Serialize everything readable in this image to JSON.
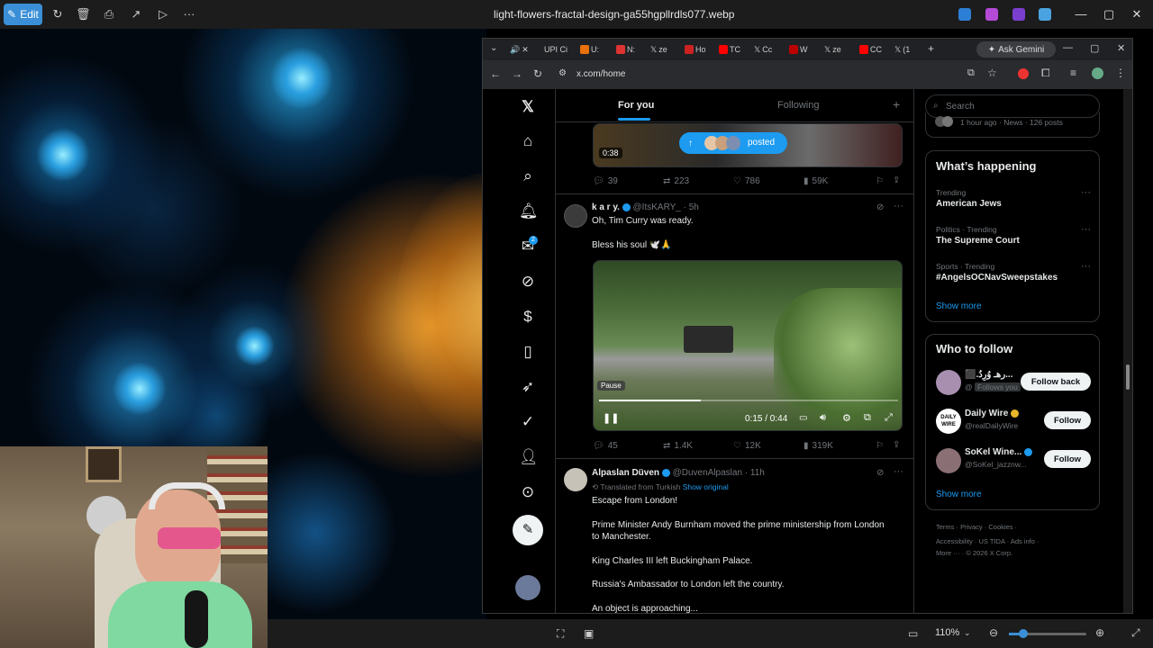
{
  "viewer": {
    "edit_label": "Edit",
    "file_title": "light-flowers-fractal-design-ga55hgpllrdls077.webp",
    "zoom_level": "110%"
  },
  "browser": {
    "tabs": [
      "UPI Ci",
      "U:",
      "N:",
      "ze",
      "Ho",
      "TC",
      "Cc",
      "W",
      "ze",
      "CC",
      "(1"
    ],
    "ask_gemini": "Ask Gemini",
    "url": "x.com/home"
  },
  "x": {
    "feed_tabs": {
      "for_you": "For you",
      "following": "Following"
    },
    "top_video": {
      "duration": "0:38",
      "posted_label": "posted"
    },
    "tweet1_actions": {
      "replies": "39",
      "reposts": "223",
      "likes": "786",
      "views": "59K"
    },
    "tweet2": {
      "name": "k a r y.",
      "handle": "@ItsKARY_ · 5h",
      "line1": "Oh, Tim Curry was ready.",
      "line2": "Bless his soul 🕊️🙏",
      "pause_tip": "Pause",
      "time": "0:15 / 0:44",
      "replies": "45",
      "reposts": "1.4K",
      "likes": "12K",
      "views": "319K"
    },
    "tweet3": {
      "name": "Alpaslan Düven",
      "handle": "@DuvenAlpaslan · 11h",
      "translated": "Translated from Turkish",
      "show_original": "Show original",
      "p1": "Escape from London!",
      "p2a": "Prime Minister Andy Burnham moved the prime ministership from London",
      "p2b": "to Manchester.",
      "p3": "King Charles III left Buckingham Palace.",
      "p4": "Russia's Ambassador to London left the country.",
      "p5": "An object is approaching..."
    },
    "search_placeholder": "Search",
    "news_meta": "1 hour ago · News · 126 posts",
    "whats_happening": {
      "title": "What’s happening",
      "trends": [
        {
          "context": "Trending",
          "title": "American Jews"
        },
        {
          "context": "Politics · Trending",
          "title": "The Supreme Court"
        },
        {
          "context": "Sports · Trending",
          "title": "#AngelsOCNavSweepstakes"
        }
      ],
      "show_more": "Show more"
    },
    "who_to_follow": {
      "title": "Who to follow",
      "users": [
        {
          "name": "⬛.رهـ وُرِدُ...",
          "handle": "@",
          "note": "Follows you",
          "button": "Follow back"
        },
        {
          "name": "Daily Wire",
          "handle": "@realDailyWire",
          "button": "Follow"
        },
        {
          "name": "SoKel Wine...",
          "handle": "@SoKel_jazznw...",
          "button": "Follow"
        }
      ],
      "show_more": "Show more"
    },
    "footer": {
      "line1": [
        "Terms",
        "Privacy",
        "Cookies"
      ],
      "line2": [
        "Accessibility",
        "US TIDA",
        "Ads info"
      ],
      "line3": [
        "More ···",
        "© 2026 X Corp."
      ]
    },
    "notification_count": "2"
  },
  "colors": {
    "accent": "#1d9bf0",
    "edit_btn": "#3a8fd6"
  }
}
